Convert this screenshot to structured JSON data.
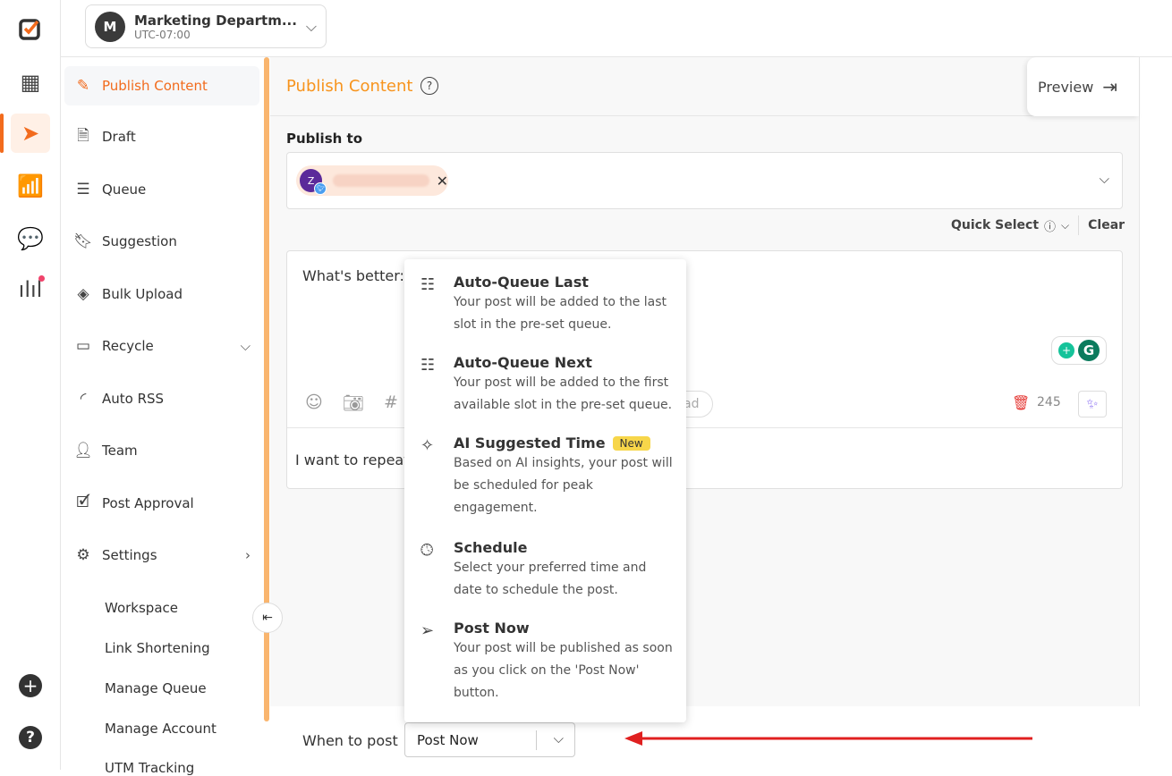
{
  "workspace": {
    "initial": "M",
    "name": "Marketing Departm...",
    "timezone": "UTC-07:00"
  },
  "rail": {
    "icons": [
      "logo-icon",
      "calendar-icon",
      "publish-send-icon",
      "analytics-icon",
      "inbox-chat-icon",
      "listening-icon",
      "add-icon",
      "help-icon"
    ]
  },
  "sidebar": {
    "items": [
      {
        "label": "Publish Content",
        "icon": "pencil-icon",
        "active": true
      },
      {
        "label": "Draft",
        "icon": "document-icon"
      },
      {
        "label": "Queue",
        "icon": "list-icon"
      },
      {
        "label": "Suggestion",
        "icon": "bookmark-icon"
      },
      {
        "label": "Bulk Upload",
        "icon": "layers-icon"
      },
      {
        "label": "Recycle",
        "icon": "archive-icon",
        "expand": "down"
      },
      {
        "label": "Auto RSS",
        "icon": "rss-icon"
      },
      {
        "label": "Team",
        "icon": "user-icon"
      },
      {
        "label": "Post Approval",
        "icon": "approval-doc-icon"
      },
      {
        "label": "Settings",
        "icon": "gear-icon",
        "expand": "right"
      }
    ],
    "subitems": [
      "Workspace",
      "Link Shortening",
      "Manage Queue",
      "Manage Account",
      "UTM Tracking"
    ]
  },
  "header": {
    "title": "Publish Content",
    "preview_label": "Preview"
  },
  "publish_to": {
    "label": "Publish to",
    "account_initial": "Z",
    "quick_select": "Quick Select",
    "clear": "Clear"
  },
  "editor": {
    "text": "What's better: I",
    "char_count": "245",
    "lead_partial": "ad",
    "repeat_text": "I want to repeat"
  },
  "menu": {
    "items": [
      {
        "title": "Auto-Queue Last",
        "desc": "Your post will be added to the last slot in the pre-set queue.",
        "icon": "queue-last-icon"
      },
      {
        "title": "Auto-Queue Next",
        "desc": "Your post will be added to the first available slot in the pre-set queue.",
        "icon": "queue-next-icon"
      },
      {
        "title": "AI Suggested Time",
        "badge": "New",
        "desc": "Based on AI insights, your post will be scheduled for peak engagement.",
        "icon": "sparkle-icon"
      },
      {
        "title": "Schedule",
        "desc": "Select your preferred time and date to schedule the post.",
        "icon": "clock-icon"
      },
      {
        "title": "Post Now",
        "desc": "Your post will be published as soon as you click on the 'Post Now' button.",
        "icon": "send-icon"
      }
    ]
  },
  "when_to_post": {
    "label": "When to post",
    "selected": "Post Now"
  },
  "colors": {
    "accent": "#f26b1d",
    "title": "#f7941d",
    "arrow": "#e02020",
    "badge": "#f7d64a"
  }
}
